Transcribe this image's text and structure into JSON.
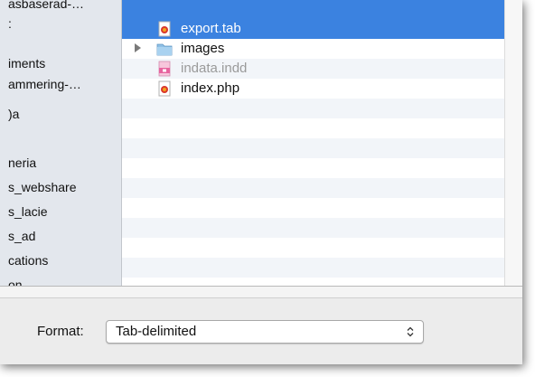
{
  "sidebar": {
    "items": [
      {
        "label": "asbaserad-…"
      },
      {
        "label": ":"
      },
      {
        "label": "iments"
      },
      {
        "label": "ammering-…"
      },
      {
        "label": ")a"
      },
      {
        "label": ""
      },
      {
        "label": "neria"
      },
      {
        "label": "s_webshare"
      },
      {
        "label": "s_lacie"
      },
      {
        "label": "s_ad"
      },
      {
        "label": "cations"
      },
      {
        "label": "on"
      }
    ]
  },
  "files": [
    {
      "name": "export.tab",
      "icon": "document-red-icon",
      "selected": true
    },
    {
      "name": "images",
      "icon": "folder-icon",
      "selected": false
    },
    {
      "name": "indata.indd",
      "icon": "indesign-file-icon",
      "selected": false,
      "dimmed": true
    },
    {
      "name": "index.php",
      "icon": "document-red-icon",
      "selected": false
    }
  ],
  "format": {
    "label": "Format:",
    "value": "Tab-delimited"
  },
  "colors": {
    "selection": "#3b82e0",
    "sidebar_bg": "#e3e7ed",
    "alt_row": "#f2f5f9",
    "window_bg": "#ececec"
  }
}
